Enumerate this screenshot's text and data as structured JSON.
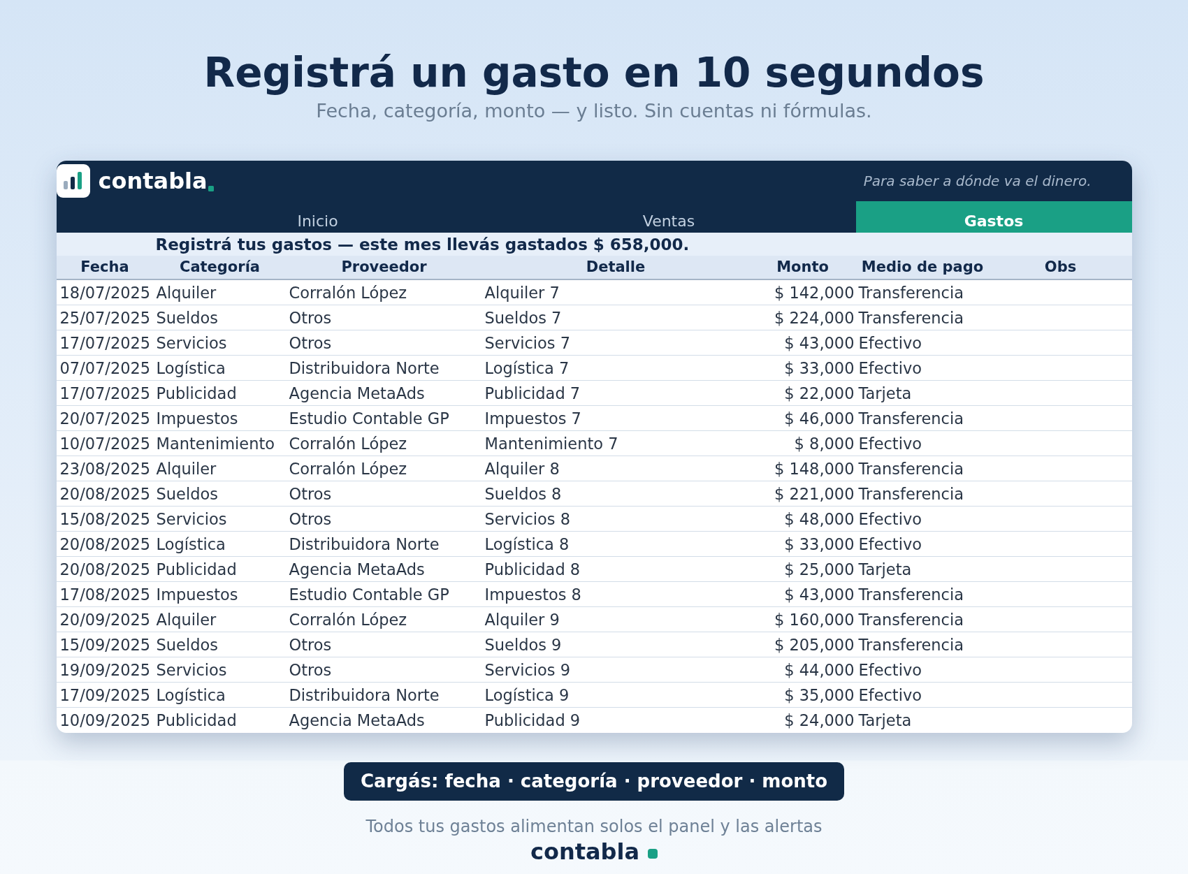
{
  "hero": {
    "title": "Registrá un gasto en 10 segundos",
    "subtitle": "Fecha, categoría, monto — y listo. Sin cuentas ni fórmulas."
  },
  "app": {
    "brand": "contabla",
    "tagline": "Para saber a dónde va el dinero.",
    "tabs": [
      {
        "label": "Inicio",
        "selected": false
      },
      {
        "label": "Ventas",
        "selected": false
      },
      {
        "label": "Gastos",
        "selected": true
      }
    ],
    "banner": "Registrá tus gastos — este mes llevás gastados $ 658,000.",
    "table": {
      "columns": [
        "Fecha",
        "Categoría",
        "Proveedor",
        "Detalle",
        "Monto",
        "Medio de pago",
        "Obs"
      ],
      "rows": [
        [
          "18/07/2025",
          "Alquiler",
          "Corralón López",
          "Alquiler 7",
          "$ 142,000",
          "Transferencia"
        ],
        [
          "25/07/2025",
          "Sueldos",
          "Otros",
          "Sueldos 7",
          "$ 224,000",
          "Transferencia"
        ],
        [
          "17/07/2025",
          "Servicios",
          "Otros",
          "Servicios 7",
          "$ 43,000",
          "Efectivo"
        ],
        [
          "07/07/2025",
          "Logística",
          "Distribuidora Norte",
          "Logística 7",
          "$ 33,000",
          "Efectivo"
        ],
        [
          "17/07/2025",
          "Publicidad",
          "Agencia MetaAds",
          "Publicidad 7",
          "$ 22,000",
          "Tarjeta"
        ],
        [
          "20/07/2025",
          "Impuestos",
          "Estudio Contable GP",
          "Impuestos 7",
          "$ 46,000",
          "Transferencia"
        ],
        [
          "10/07/2025",
          "Mantenimiento",
          "Corralón López",
          "Mantenimiento 7",
          "$ 8,000",
          "Efectivo"
        ],
        [
          "23/08/2025",
          "Alquiler",
          "Corralón López",
          "Alquiler 8",
          "$ 148,000",
          "Transferencia"
        ],
        [
          "20/08/2025",
          "Sueldos",
          "Otros",
          "Sueldos 8",
          "$ 221,000",
          "Transferencia"
        ],
        [
          "15/08/2025",
          "Servicios",
          "Otros",
          "Servicios 8",
          "$ 48,000",
          "Efectivo"
        ],
        [
          "20/08/2025",
          "Logística",
          "Distribuidora Norte",
          "Logística 8",
          "$ 33,000",
          "Efectivo"
        ],
        [
          "20/08/2025",
          "Publicidad",
          "Agencia MetaAds",
          "Publicidad 8",
          "$ 25,000",
          "Tarjeta"
        ],
        [
          "17/08/2025",
          "Impuestos",
          "Estudio Contable GP",
          "Impuestos 8",
          "$ 43,000",
          "Transferencia"
        ],
        [
          "20/09/2025",
          "Alquiler",
          "Corralón López",
          "Alquiler 9",
          "$ 160,000",
          "Transferencia"
        ],
        [
          "15/09/2025",
          "Sueldos",
          "Otros",
          "Sueldos 9",
          "$ 205,000",
          "Transferencia"
        ],
        [
          "19/09/2025",
          "Servicios",
          "Otros",
          "Servicios 9",
          "$ 44,000",
          "Efectivo"
        ],
        [
          "17/09/2025",
          "Logística",
          "Distribuidora Norte",
          "Logística 9",
          "$ 35,000",
          "Efectivo"
        ],
        [
          "10/09/2025",
          "Publicidad",
          "Agencia MetaAds",
          "Publicidad 9",
          "$ 24,000",
          "Tarjeta"
        ]
      ]
    }
  },
  "callout": "Cargás: fecha · categoría · proveedor · monto",
  "footer": {
    "text": "Todos tus gastos alimentan solos el panel y las alertas",
    "brand": "contabla"
  }
}
